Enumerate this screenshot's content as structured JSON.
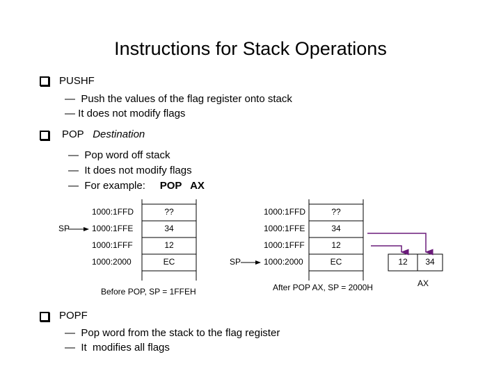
{
  "title": "Instructions for Stack Operations",
  "sections": [
    {
      "heading": "PUSHF",
      "heading_suffix": "",
      "items": [
        "Push the values of the flag register onto stack",
        "It does not modify flags"
      ]
    },
    {
      "heading": "POP",
      "heading_suffix": "Destination",
      "items": [
        "Pop word off stack",
        "It does not modify flags",
        "For example:"
      ],
      "example_code": "POP   AX"
    },
    {
      "heading": "POPF",
      "heading_suffix": "",
      "items": [
        "Pop word from the stack to the flag register",
        "It  modifies all flags"
      ]
    }
  ],
  "dash": "—",
  "before_stack": {
    "pointer_label": "SP",
    "pointer_row": 1,
    "rows": [
      {
        "address": "1000:1FFD",
        "value": "??"
      },
      {
        "address": "1000:1FFE",
        "value": "34"
      },
      {
        "address": "1000:1FFF",
        "value": "12"
      },
      {
        "address": "1000:2000",
        "value": "EC"
      }
    ],
    "caption": "Before POP, SP = 1FFEH"
  },
  "after_stack": {
    "pointer_label": "SP",
    "pointer_row": 3,
    "rows": [
      {
        "address": "1000:1FFD",
        "value": "??"
      },
      {
        "address": "1000:1FFE",
        "value": "34"
      },
      {
        "address": "1000:1FFF",
        "value": "12"
      },
      {
        "address": "1000:2000",
        "value": "EC"
      }
    ],
    "caption": "After POP AX,  SP = 2000H"
  },
  "register": {
    "name": "AX",
    "high": "12",
    "low": "34"
  },
  "colors": {
    "arrow": "#6a1b7a",
    "text": "#000000"
  }
}
